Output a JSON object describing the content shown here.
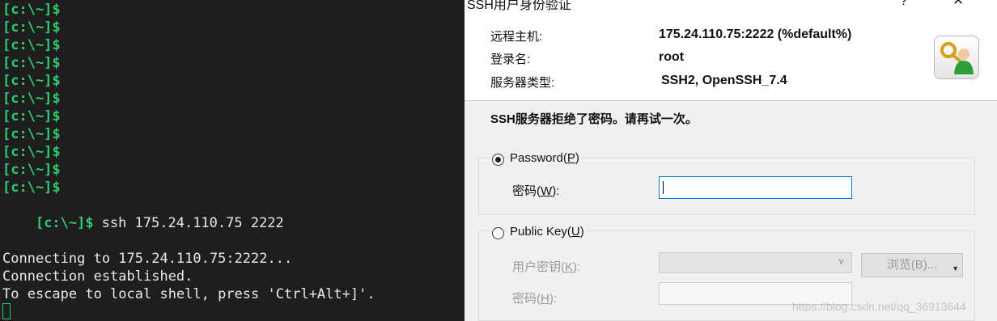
{
  "terminal": {
    "prompt": "[c:\\~]$",
    "command": "ssh 175.24.110.75 2222",
    "output": [
      "Connecting to 175.24.110.75:2222...",
      "Connection established.",
      "To escape to local shell, press 'Ctrl+Alt+]'."
    ]
  },
  "dialog": {
    "title": "SSH用户身份验证",
    "help_button": "?",
    "close_button": "✕",
    "info": {
      "remote_host_label": "远程主机:",
      "remote_host_value": "175.24.110.75:2222 (%default%)",
      "login_name_label": "登录名:",
      "login_name_value": "root",
      "server_type_label": "服务器类型:",
      "server_type_value": "SSH2, OpenSSH_7.4"
    },
    "message": "SSH服务器拒绝了密码。请再试一次。",
    "password_method": {
      "label": "Password",
      "mnemonic": "P",
      "selected": true,
      "password_label": "密码",
      "password_mnemonic": "W",
      "password_value": ""
    },
    "publickey_method": {
      "label": "Public Key",
      "mnemonic": "U",
      "selected": false,
      "user_key_label": "用户密钥",
      "user_key_mnemonic": "K",
      "user_key_value": "",
      "browse_label": "浏览(B)...",
      "passphrase_label": "密码",
      "passphrase_mnemonic": "H"
    },
    "watermark": "https://blog.csdn.net/qq_36913644"
  },
  "colors": {
    "terminal_bg": "#1e1e1e",
    "prompt_green": "#2ecc71",
    "dialog_bg": "#f0f0f0",
    "focus_blue": "#0078d7"
  }
}
